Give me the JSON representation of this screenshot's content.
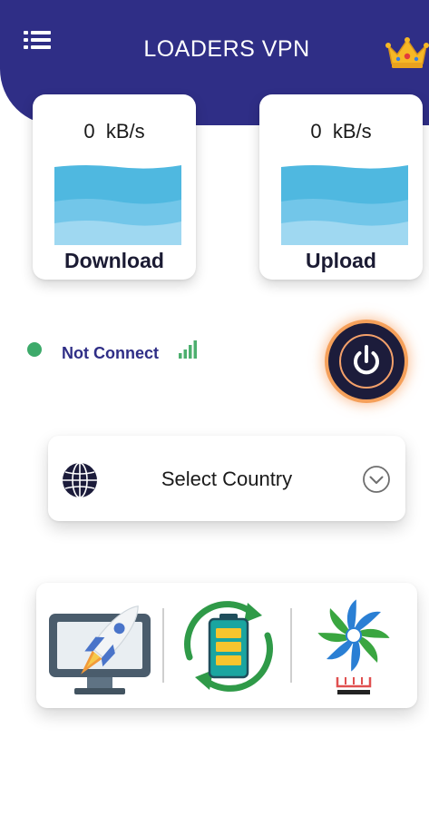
{
  "header": {
    "title": "LOADERS VPN",
    "menu_icon": "menu-icon",
    "premium_icon": "crown-icon"
  },
  "speed": {
    "download": {
      "value": "0  kB/s",
      "label": "Download"
    },
    "upload": {
      "value": "0  kB/s",
      "label": "Upload"
    }
  },
  "status": {
    "text": "Not Connect",
    "dot_color": "#3daa6a",
    "signal_icon": "signal-bars-icon"
  },
  "power": {
    "icon": "power-icon"
  },
  "country": {
    "placeholder": "Select Country",
    "left_icon": "globe-icon",
    "right_icon": "chevron-down-circle-icon"
  },
  "tools": [
    {
      "name": "booster",
      "icon": "rocket-monitor-icon"
    },
    {
      "name": "battery-saver",
      "icon": "battery-recycle-icon"
    },
    {
      "name": "cpu-cooler",
      "icon": "fan-cooler-icon"
    }
  ],
  "colors": {
    "primary": "#2f2e86",
    "wave": "#4fb8e0",
    "power_glow": "#f5a05a"
  }
}
